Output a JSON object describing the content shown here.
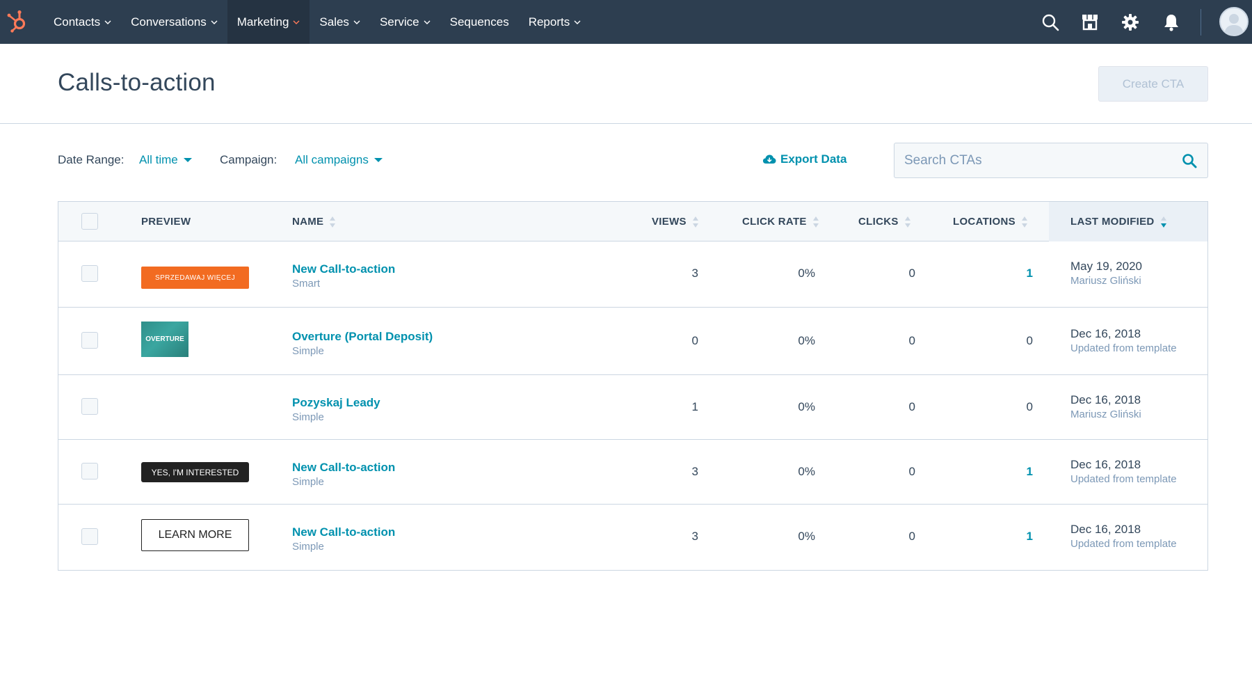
{
  "nav": {
    "items": [
      {
        "label": "Contacts",
        "dropdown": true,
        "active": false
      },
      {
        "label": "Conversations",
        "dropdown": true,
        "active": false
      },
      {
        "label": "Marketing",
        "dropdown": true,
        "active": true
      },
      {
        "label": "Sales",
        "dropdown": true,
        "active": false
      },
      {
        "label": "Service",
        "dropdown": true,
        "active": false
      },
      {
        "label": "Sequences",
        "dropdown": false,
        "active": false
      },
      {
        "label": "Reports",
        "dropdown": true,
        "active": false
      }
    ],
    "icons": [
      "search-icon",
      "marketplace-icon",
      "settings-icon",
      "notifications-icon"
    ],
    "colors": {
      "bar": "#2d3e50",
      "active": "#253342",
      "accent": "#ff7a59"
    }
  },
  "header": {
    "title": "Calls-to-action",
    "create_label": "Create CTA"
  },
  "filters": {
    "date_range_label": "Date Range:",
    "date_range_value": "All time",
    "campaign_label": "Campaign:",
    "campaign_value": "All campaigns",
    "export_label": "Export Data"
  },
  "search": {
    "placeholder": "Search CTAs",
    "value": ""
  },
  "table": {
    "columns": {
      "preview": "PREVIEW",
      "name": "NAME",
      "views": "VIEWS",
      "click_rate": "CLICK RATE",
      "clicks": "CLICKS",
      "locations": "LOCATIONS",
      "last_modified": "LAST MODIFIED"
    },
    "rows": [
      {
        "preview": "SPRZEDAWAJ WIĘCEJ",
        "name": "New Call-to-action",
        "type": "Smart",
        "views": "3",
        "click_rate": "0%",
        "clicks": "0",
        "locations": "1",
        "date": "May 19, 2020",
        "modified_by": "Mariusz Gliński"
      },
      {
        "preview": "OVERTURE",
        "name": "Overture (Portal Deposit)",
        "type": "Simple",
        "views": "0",
        "click_rate": "0%",
        "clicks": "0",
        "locations": "0",
        "date": "Dec 16, 2018",
        "modified_by": "Updated from template"
      },
      {
        "preview": "",
        "name": "Pozyskaj Leady",
        "type": "Simple",
        "views": "1",
        "click_rate": "0%",
        "clicks": "0",
        "locations": "0",
        "date": "Dec 16, 2018",
        "modified_by": "Mariusz Gliński"
      },
      {
        "preview": "YES, I'M INTERESTED",
        "name": "New Call-to-action",
        "type": "Simple",
        "views": "3",
        "click_rate": "0%",
        "clicks": "0",
        "locations": "1",
        "date": "Dec 16, 2018",
        "modified_by": "Updated from template"
      },
      {
        "preview": "LEARN MORE",
        "name": "New Call-to-action",
        "type": "Simple",
        "views": "3",
        "click_rate": "0%",
        "clicks": "0",
        "locations": "1",
        "date": "Dec 16, 2018",
        "modified_by": "Updated from template"
      }
    ]
  }
}
